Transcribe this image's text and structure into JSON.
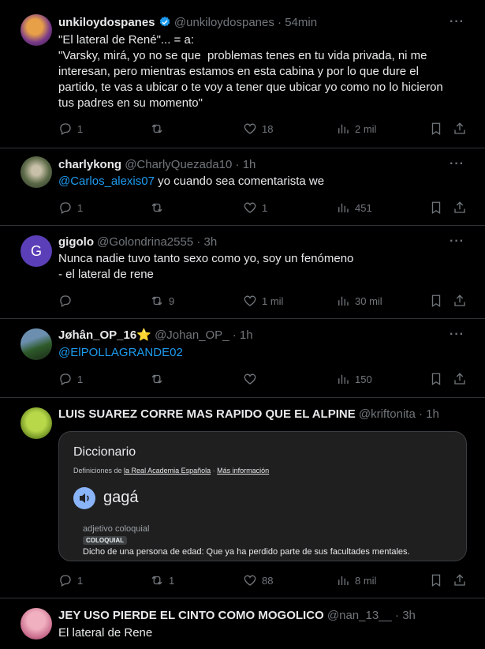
{
  "tweets": [
    {
      "name": "unkiloydospanes",
      "handle": "@unkiloydospanes",
      "time": "54min",
      "verified": true,
      "lines": [
        "\"El lateral de René\"... = a:",
        "\"Varsky, mirá, yo no se que  problemas tenes en tu vida privada, ni me",
        "interesan, pero mientras estamos en esta cabina y por lo que dure el",
        "partido, te vas a ubicar o te voy a tener que ubicar yo como no lo hicieron",
        "tus padres en su momento\""
      ],
      "replies": "1",
      "retweets": "",
      "likes": "18",
      "views": "2 mil"
    },
    {
      "name": "charlykong",
      "handle": "@CharlyQuezada10",
      "time": "1h",
      "mention": "@Carlos_alexis07",
      "text": " yo cuando sea comentarista we",
      "replies": "1",
      "retweets": "",
      "likes": "1",
      "views": "451"
    },
    {
      "name": "gigolo",
      "handle": "@Golondrina2555",
      "time": "3h",
      "avatar_letter": "G",
      "lines": [
        "Nunca nadie tuvo tanto sexo como yo, soy un fenómeno",
        "- el lateral de rene"
      ],
      "replies": "",
      "retweets": "9",
      "likes": "1 mil",
      "views": "30 mil"
    },
    {
      "name": "Jøhân_OP_16",
      "name_emoji": "⭐",
      "handle": "@Johan_OP_",
      "time": "1h",
      "mention": "@ElPOLLAGRANDE02",
      "replies": "1",
      "retweets": "",
      "likes": "",
      "views": "150"
    },
    {
      "name": "LUIS SUAREZ CORRE MAS RAPIDO QUE EL ALPINE",
      "handle": "@kriftonita",
      "time": "1h",
      "dictionary": {
        "title": "Diccionario",
        "subtitle_prefix": "Definiciones de ",
        "subtitle_link1": "la Real Academia Española",
        "subtitle_sep": " · ",
        "subtitle_link2": "Más información",
        "word": "gagá",
        "pos": "adjetivo coloquial",
        "badge": "COLOQUIAL",
        "definition": "Dicho de una persona de edad: Que ya ha perdido parte de sus facultades mentales."
      },
      "replies": "1",
      "retweets": "1",
      "likes": "88",
      "views": "8 mil"
    },
    {
      "name": "JEY USO PIERDE EL CINTO COMO MOGOLICO",
      "handle": "@nan_13__",
      "time": "3h",
      "lines": [
        "El lateral de Rene"
      ]
    }
  ],
  "more_label": "···",
  "dot": "·",
  "colors": {
    "accent": "#1d9bf0",
    "muted": "#71767b",
    "text": "#e7e9ea",
    "border": "#2f3336"
  }
}
